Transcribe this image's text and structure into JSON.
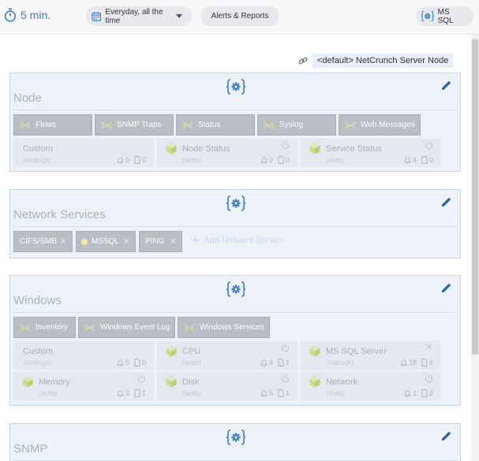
{
  "topbar": {
    "interval": "5 min.",
    "schedule": "Everyday, all the time",
    "alerts_reports": "Alerts & Reports",
    "db_label": "MS SQL"
  },
  "server": {
    "name": "<default> NetCrunch Server Node"
  },
  "sections": {
    "node": {
      "title": "Node",
      "buttons": [
        "Flows",
        "SNMP Traps",
        "Status",
        "Syslog",
        "Web Messages"
      ],
      "tiles": [
        {
          "name": "Custom",
          "sub": "(settings)",
          "alerts": "0",
          "reports": "0"
        },
        {
          "name": "Node Status",
          "sub": "(auto)",
          "alerts": "2",
          "reports": "0"
        },
        {
          "name": "Service Status",
          "sub": "(auto)",
          "alerts": "4",
          "reports": "0"
        }
      ]
    },
    "network_services": {
      "title": "Network Services",
      "chips": [
        "CIFS/SMB",
        "MSSQL",
        "PING"
      ],
      "add_label": "Add Network Service"
    },
    "windows": {
      "title": "Windows",
      "buttons": [
        "Inventory",
        "Windows Event Log",
        "Windows Services"
      ],
      "tiles": [
        {
          "name": "Custom",
          "sub": "(settings)",
          "alerts": "0",
          "reports": "0"
        },
        {
          "name": "CPU",
          "sub": "(auto)",
          "alerts": "4",
          "reports": "1"
        },
        {
          "name": "MS SQL Server",
          "sub": "(manual)",
          "alerts": "18",
          "reports": "6"
        },
        {
          "name": "Memory",
          "sub": "(auto)",
          "alerts": "3",
          "reports": "1"
        },
        {
          "name": "Disk",
          "sub": "(auto)",
          "alerts": "5",
          "reports": "1"
        },
        {
          "name": "Network",
          "sub": "(auto)",
          "alerts": "1",
          "reports": "2"
        }
      ]
    },
    "snmp": {
      "title": "SNMP"
    }
  },
  "icons": {
    "timer": "stopwatch-icon",
    "calendar": "calendar-icon",
    "settings": "gear-braces-icon",
    "edit": "pencil-icon",
    "link": "link-icon",
    "monitor": "wave-icon",
    "pack": "cube-icon",
    "power": "power-icon",
    "bell": "bell-icon",
    "doc": "document-icon"
  },
  "colors": {
    "accent": "#3f7cc0",
    "panel_bg": "#edf2f9",
    "panel_border": "#c6d6ea",
    "button_grey": "#b9bec4",
    "cube_green": "#cfe29a"
  }
}
